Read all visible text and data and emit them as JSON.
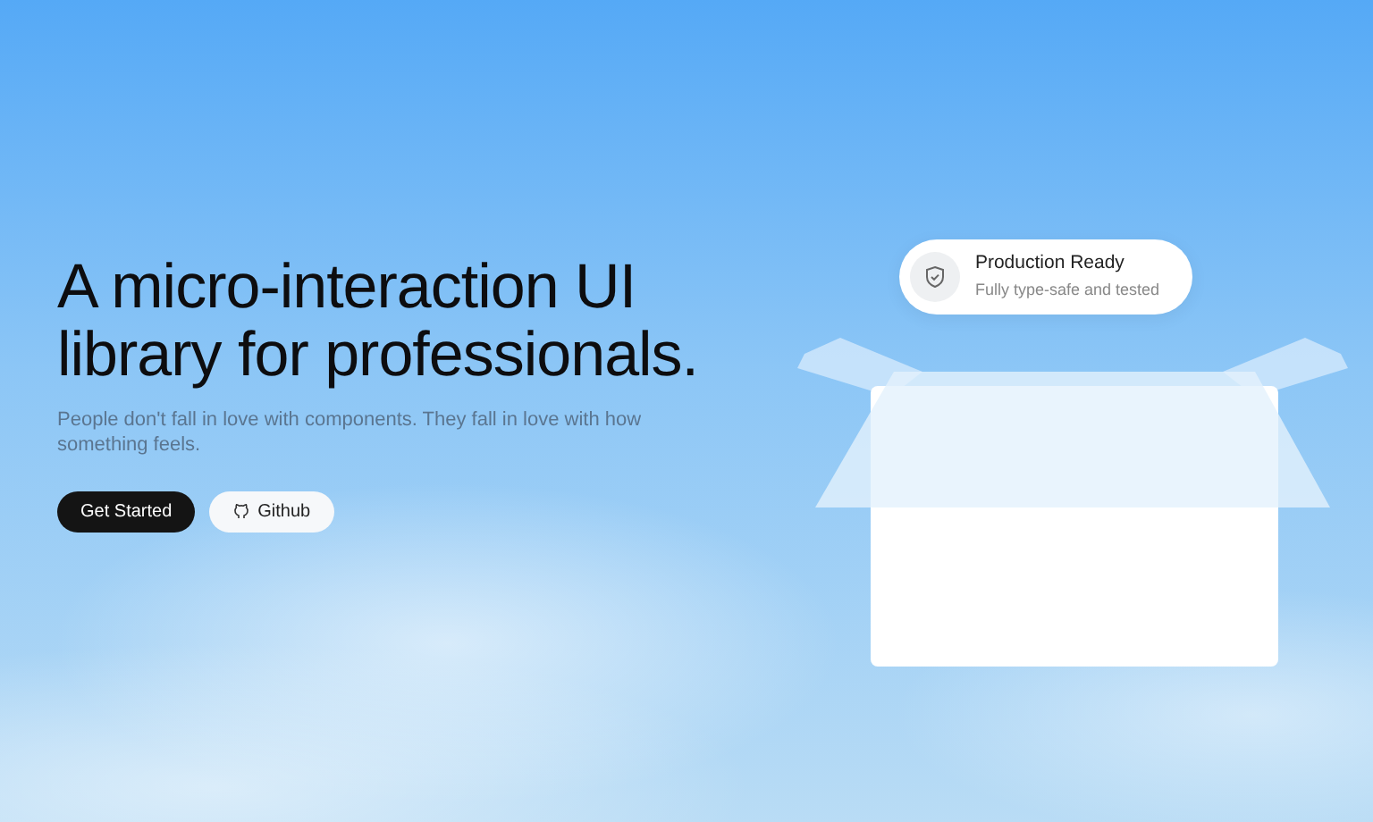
{
  "hero": {
    "headline": "A micro-interaction UI library for professionals.",
    "subtitle": "People don't fall in love with components. They fall in love with how something feels.",
    "buttons": [
      {
        "label": "Get Started",
        "kind": "primary"
      },
      {
        "label": "Github",
        "kind": "secondary"
      }
    ]
  },
  "badge_card": {
    "title": "Production Ready",
    "subtitle": "Fully type-safe and tested"
  }
}
